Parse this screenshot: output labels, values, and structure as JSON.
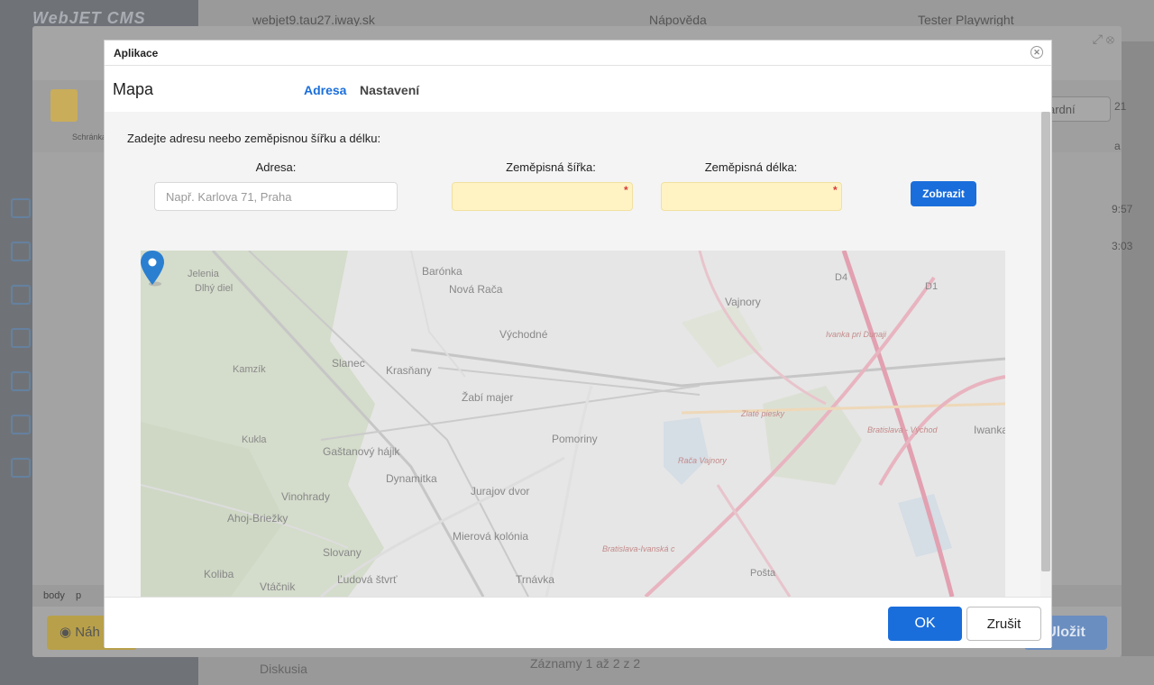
{
  "background": {
    "logo": "WebJET CMS",
    "domain": "webjet9.tau27.iway.sk",
    "help": "Nápověda",
    "user": "Tester Playwright",
    "records": "Záznamy 1 až 2 z 2",
    "folder": "Diskusia"
  },
  "editor": {
    "paste_label": "Schránka",
    "status_tags": [
      "body",
      "p"
    ],
    "preview_label": "Náh",
    "save_label": "Uložit",
    "select_value": "ardní",
    "page_number": "21",
    "right_texts": [
      "a",
      "9:57",
      "3:03"
    ]
  },
  "dialog": {
    "title": "Aplikace",
    "plugin_name": "Mapa",
    "tabs": [
      {
        "label": "Adresa",
        "active": true
      },
      {
        "label": "Nastavení",
        "active": false
      }
    ],
    "instruction": "Zadejte adresu neebo zeměpisnou šířku a délku:",
    "fields": {
      "address": {
        "label": "Adresa:",
        "placeholder": "Např. Karlova 71, Praha",
        "value": ""
      },
      "latitude": {
        "label": "Zeměpisná šířka:",
        "value": "",
        "required": true
      },
      "longitude": {
        "label": "Zeměpisná délka:",
        "value": "",
        "required": true
      }
    },
    "show_button": "Zobrazit",
    "ok_button": "OK",
    "cancel_button": "Zrušit"
  },
  "map": {
    "pin_location": "Pomoriny",
    "labels": [
      "Barónka",
      "Nová Rača",
      "Vajnory",
      "Východné",
      "Slanec",
      "Krasňany",
      "Žabí majer",
      "Pomoriny",
      "Ivanka pri Dunaji",
      "Gaštanový hájik",
      "Dynamitka",
      "Vinohrady",
      "Ahoj-Briežky",
      "Jurajov dvor",
      "Mierová kolónia",
      "Slovany",
      "Koliba",
      "Ľudová štvrť",
      "Trnávka",
      "Vtáčnik",
      "Iwanka",
      "Bratislava - Východ",
      "Zlaté piesky",
      "Rača Vajnory",
      "Bratislava-Ivanská c",
      "Jelenia",
      "Dlhý diel",
      "Kamzík",
      "Kukla",
      "D4",
      "D1",
      "Pošta"
    ],
    "colors": {
      "roads": "#e8b4c0",
      "motorway": "#e2a0b0",
      "forest": "#d4dccb",
      "base": "#e6e6e6",
      "pin": "#2a7fd0"
    }
  }
}
